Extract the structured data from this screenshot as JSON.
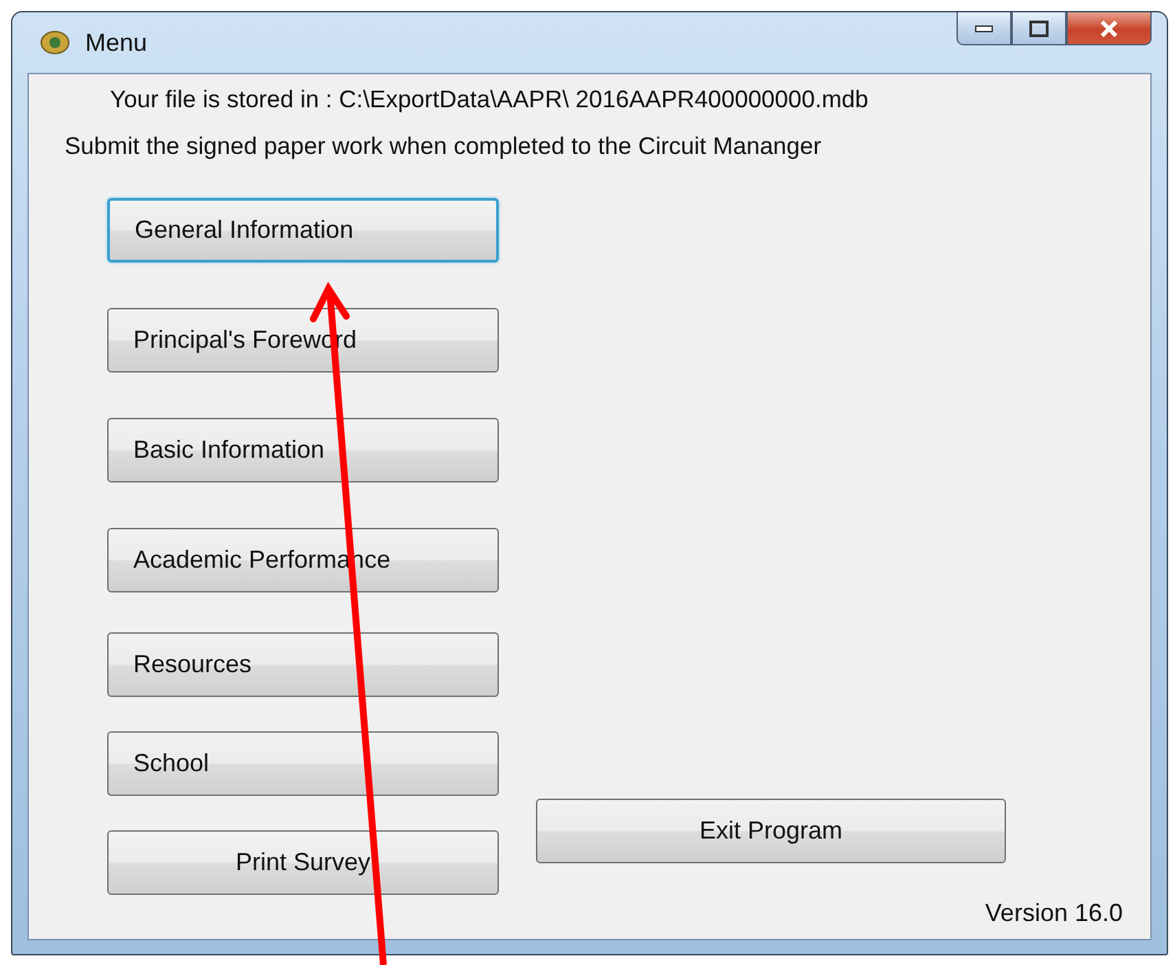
{
  "window": {
    "title": "Menu"
  },
  "info_lines": [
    "Your file is stored in : C:\\ExportData\\AAPR\\ 2016AAPR400000000.mdb",
    "Submit the signed paper work when completed to the Circuit Mananger"
  ],
  "menu_buttons": [
    {
      "label": "General Information",
      "focused": true
    },
    {
      "label": "Principal's Foreword",
      "focused": false
    },
    {
      "label": "Basic Information",
      "focused": false
    },
    {
      "label": "Academic Performance",
      "focused": false
    },
    {
      "label": "Resources",
      "focused": false
    },
    {
      "label": "School",
      "focused": false
    },
    {
      "label": "Print Survey",
      "focused": false
    }
  ],
  "exit_button": {
    "label": "Exit Program"
  },
  "version": "Version 16.0"
}
